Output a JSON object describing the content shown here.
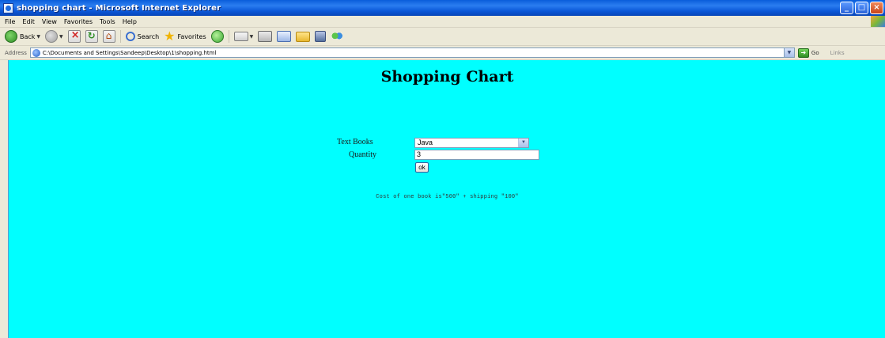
{
  "window": {
    "title": "shopping chart - Microsoft Internet Explorer",
    "controls": [
      "_",
      "□",
      "×"
    ]
  },
  "menubar": {
    "items": [
      "File",
      "Edit",
      "View",
      "Favorites",
      "Tools",
      "Help"
    ]
  },
  "toolbar": {
    "back_label": "Back",
    "search_label": "Search",
    "favorites_label": "Favorites"
  },
  "addressbar": {
    "label": "Address",
    "url": "C:\\Documents and Settings\\Sandeep\\Desktop\\1\\shopping.html",
    "go_label": "Go",
    "links_label": "Links"
  },
  "page": {
    "background_color": "#00ffff",
    "title": "Shopping Chart",
    "textbooks_label": "Text Books",
    "textbooks_selected": "Java",
    "quantity_label": "Quantity",
    "quantity_value": "3",
    "ok_label": "ok",
    "result": "Cost of one book is\"500\" + shipping \"100\""
  }
}
